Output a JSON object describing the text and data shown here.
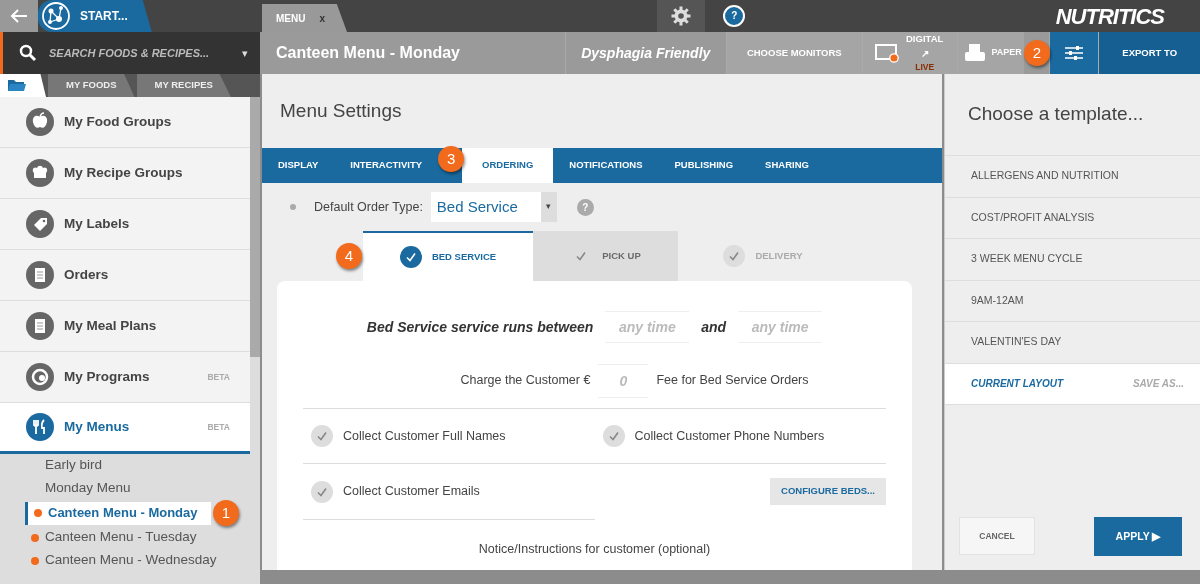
{
  "start_tab": {
    "label": "START..."
  },
  "doc_tabs": [
    {
      "label": "MENU",
      "close": "x",
      "selected": true
    }
  ],
  "help_button": {
    "label": "?"
  },
  "logo": {
    "text": "NUTRITICS"
  },
  "search": {
    "placeholder": "SEARCH FOODS & RECIPES...",
    "caret": "▾"
  },
  "library_tabs": [
    {
      "kind": "folder",
      "selected": true
    },
    {
      "kind": "text",
      "label": "MY FOODS",
      "selected": false
    },
    {
      "kind": "text",
      "label": "MY RECIPES",
      "selected": false
    }
  ],
  "sidebar": {
    "items": [
      {
        "label": "My Food Groups",
        "selected": false
      },
      {
        "label": "My Recipe Groups",
        "selected": false
      },
      {
        "label": "My Labels",
        "selected": false
      },
      {
        "label": "Orders",
        "selected": false
      },
      {
        "label": "My Meal Plans",
        "selected": false
      },
      {
        "label": "My Programs",
        "badge": "BETA",
        "selected": false
      },
      {
        "label": "My Menus",
        "badge": "BETA",
        "selected": true
      }
    ]
  },
  "menus": [
    {
      "label": "Early bird",
      "live": false,
      "selected": false
    },
    {
      "label": "Monday Menu",
      "live": false,
      "selected": false
    },
    {
      "label": "Canteen Menu - Monday",
      "live": true,
      "selected": true,
      "callout": "1"
    },
    {
      "label": "Canteen Menu - Tuesday",
      "live": true,
      "selected": false
    },
    {
      "label": "Canteen Menu - Wednesday",
      "live": true,
      "selected": false
    }
  ],
  "document": {
    "title": "Canteen Menu - Monday",
    "tag": "Dysphagia Friendly"
  },
  "toolbar": [
    {
      "kind": "text",
      "label": "CHOOSE MONITORS",
      "selected": false
    },
    {
      "kind": "digital",
      "label": "DIGITAL ↗",
      "sub": "LIVE",
      "selected": false
    },
    {
      "kind": "paper",
      "label": "PAPER",
      "selected": false
    },
    {
      "kind": "settings",
      "selected": true,
      "callout": "2"
    },
    {
      "kind": "export",
      "label": "EXPORT TO",
      "selected": false
    }
  ],
  "settings_dialog": {
    "title": "Menu Settings",
    "tabs": [
      {
        "label": "DISPLAY",
        "selected": false
      },
      {
        "label": "INTERACTIVITY",
        "selected": false
      },
      {
        "label": "ORDERING",
        "selected": true,
        "callout": "3"
      },
      {
        "label": "NOTIFICATIONS",
        "selected": false
      },
      {
        "label": "PUBLISHING",
        "selected": false
      },
      {
        "label": "SHARING",
        "selected": false
      }
    ],
    "order_type": {
      "label": "Default Order Type:",
      "value": "Bed Service",
      "caret": "▾",
      "help": "?"
    },
    "order_tabs": [
      {
        "label": "BED SERVICE",
        "selected": true,
        "hovered": false,
        "callout": "4"
      },
      {
        "label": "PICK UP",
        "selected": false,
        "hovered": true
      },
      {
        "label": "DELIVERY",
        "selected": false,
        "hovered": false
      }
    ],
    "service_hours": {
      "label": "Bed Service service runs between",
      "from_placeholder": "any time",
      "joiner": "and",
      "to_placeholder": "any time"
    },
    "fee": {
      "label": "Charge the Customer €",
      "placeholder": "0",
      "suffix": "Fee for Bed Service Orders"
    },
    "options": [
      {
        "label": "Collect Customer Full Names",
        "checked": false
      },
      {
        "label": "Collect Customer Phone Numbers",
        "checked": false
      },
      {
        "label": "Collect Customer Emails",
        "checked": false
      }
    ],
    "configure_button": "CONFIGURE BEDS...",
    "notice_label": "Notice/Instructions for customer (optional)"
  },
  "template_panel": {
    "title": "Choose a template...",
    "templates": [
      {
        "label": "ALLERGENS AND NUTRITION",
        "selected": false
      },
      {
        "label": "COST/PROFIT ANALYSIS",
        "selected": false
      },
      {
        "label": "3 WEEK MENU CYCLE",
        "selected": false
      },
      {
        "label": "9AM-12AM",
        "selected": false
      },
      {
        "label": "VALENTIN'ES DAY",
        "selected": false
      }
    ],
    "current": {
      "label": "CURRENT LAYOUT",
      "action": "SAVE AS...",
      "selected": true
    },
    "cancel": "CANCEL",
    "apply": "APPLY ▶"
  }
}
